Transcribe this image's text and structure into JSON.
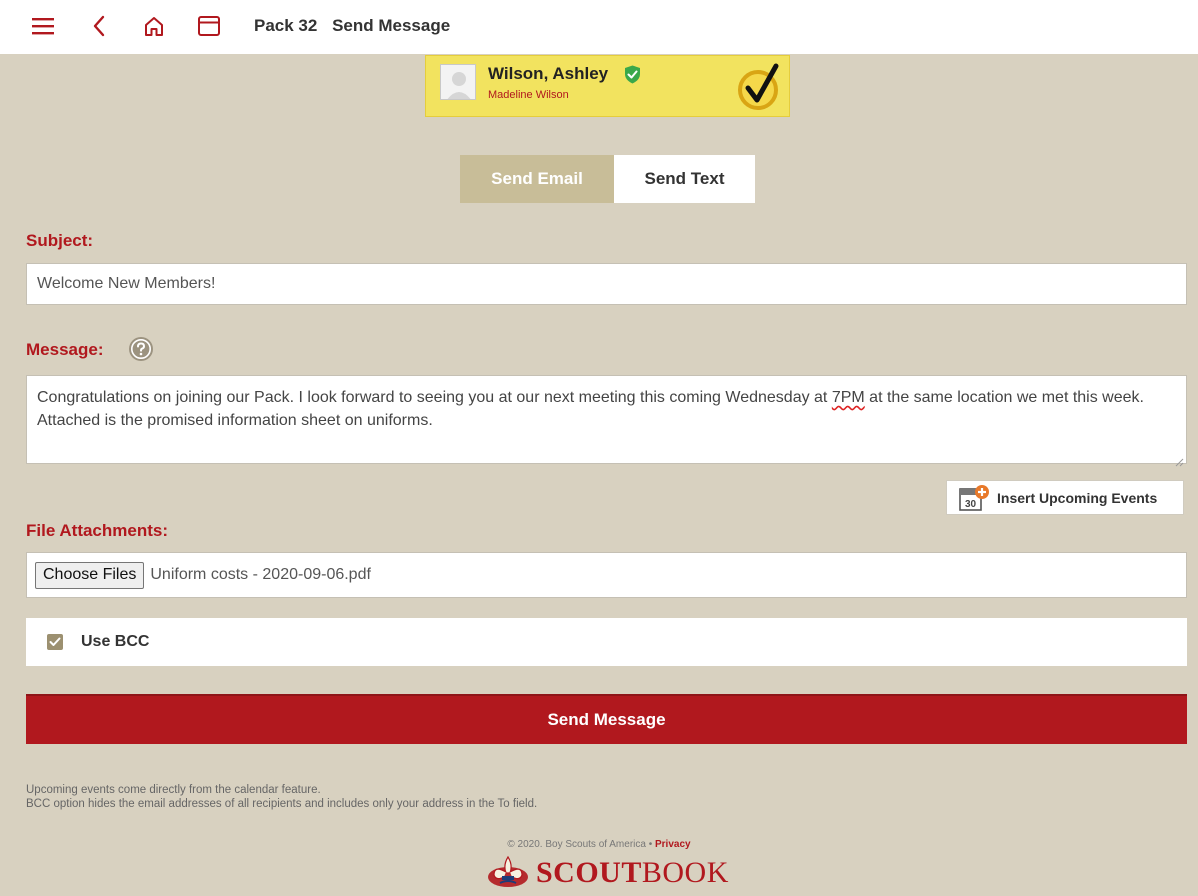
{
  "header": {
    "unit": "Pack 32",
    "page_title": "Send Message"
  },
  "member": {
    "name": "Wilson, Ashley",
    "sub": "Madeline Wilson"
  },
  "tabs": [
    {
      "label": "Send Email",
      "active": true
    },
    {
      "label": "Send Text",
      "active": false
    }
  ],
  "subject": {
    "label": "Subject:",
    "value": "Welcome New Members!"
  },
  "message": {
    "label": "Message:",
    "value_before": "Congratulations on joining our Pack. I look forward to seeing you at our next meeting this coming Wednesday at ",
    "value_flagged": "7PM",
    "value_after": " at the same location we met this week. Attached is the promised information sheet on uniforms."
  },
  "insert_events": {
    "label": "Insert Upcoming Events",
    "icon_text": "30"
  },
  "attachments": {
    "label": "File Attachments:",
    "button_label": "Choose Files",
    "file_name": "Uniform costs - 2020-09-06.pdf"
  },
  "bcc": {
    "label": "Use BCC",
    "checked": true
  },
  "send_button": "Send Message",
  "notes": [
    "Upcoming events come directly from the calendar feature.",
    "BCC option hides the email addresses of all recipients and includes only your address in the To field."
  ],
  "footer": {
    "copyright": "© 2020. Boy Scouts of America • ",
    "privacy": "Privacy",
    "logo_bold": "SCOUT",
    "logo_light": "BOOK"
  },
  "colors": {
    "accent": "#b1181e",
    "background": "#d8d1c0",
    "member_card": "#f2e35f",
    "active_tab": "#c8bd98"
  },
  "icons": [
    "menu-icon",
    "back-icon",
    "home-icon",
    "window-icon",
    "verified-shield-icon",
    "checkmark-badge-icon",
    "help-icon",
    "calendar-add-icon",
    "checkbox-checked-icon",
    "fleur-de-lis-icon"
  ]
}
